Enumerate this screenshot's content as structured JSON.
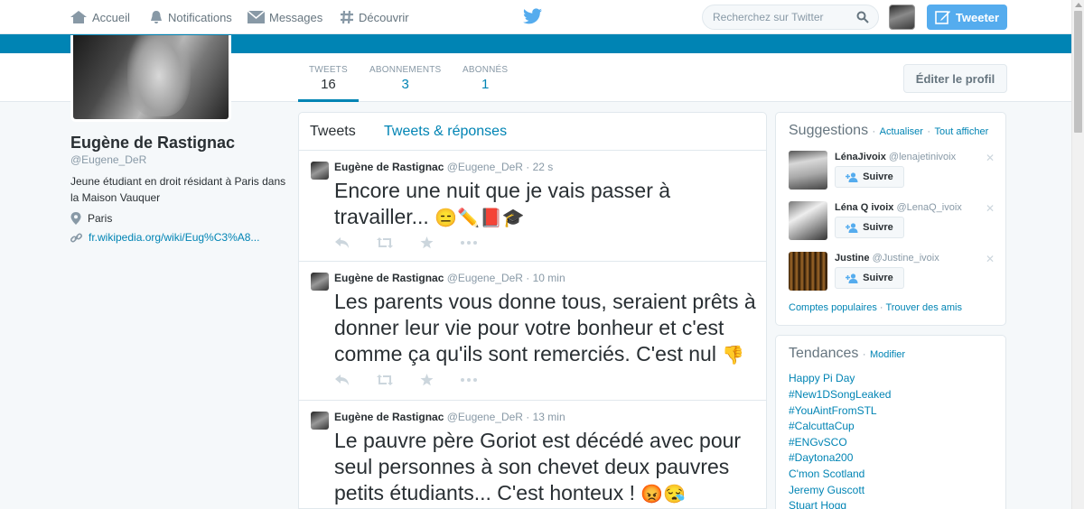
{
  "nav": {
    "home": "Accueil",
    "notifications": "Notifications",
    "messages": "Messages",
    "discover": "Découvrir",
    "search_placeholder": "Recherchez sur Twitter",
    "tweet_button": "Tweeter"
  },
  "stats": {
    "tweets_label": "TWEETS",
    "tweets_value": "16",
    "following_label": "ABONNEMENTS",
    "following_value": "3",
    "followers_label": "ABONNÉS",
    "followers_value": "1",
    "edit_profile": "Éditer le profil"
  },
  "profile": {
    "name": "Eugène de Rastignac",
    "handle": "@Eugene_DeR",
    "bio": "Jeune étudiant en droit résidant à Paris dans la Maison Vauquer",
    "location": "Paris",
    "url": "fr.wikipedia.org/wiki/Eug%C3%A8..."
  },
  "timeline": {
    "tab_tweets": "Tweets",
    "tab_replies": "Tweets & réponses",
    "tweets": [
      {
        "name": "Eugène de Rastignac",
        "handle": "@Eugene_DeR",
        "time": "· 22 s",
        "text": "Encore une nuit que je vais passer à travailler...",
        "emoji": "😑✏️📕🎓"
      },
      {
        "name": "Eugène de Rastignac",
        "handle": "@Eugene_DeR",
        "time": "· 10 min",
        "text": "Les parents vous donne tous, seraient prêts à donner leur vie pour votre bonheur et c'est comme ça qu'ils sont remerciés. C'est nul",
        "emoji": "👎"
      },
      {
        "name": "Eugène de Rastignac",
        "handle": "@Eugene_DeR",
        "time": "· 13 min",
        "text": "Le pauvre père Goriot est décédé avec pour seul personnes à son chevet deux pauvres petits étudiants... C'est honteux !",
        "emoji": "😡😪"
      }
    ]
  },
  "suggestions": {
    "title": "Suggestions",
    "refresh": "Actualiser",
    "view_all": "Tout afficher",
    "follow_label": "Suivre",
    "dismiss": "✕",
    "items": [
      {
        "name": "LénaJivoix",
        "handle": "@lenajetinivoix"
      },
      {
        "name": "Léna Q ivoix",
        "handle": "@LenaQ_ivoix"
      },
      {
        "name": "Justine",
        "handle": "@Justine_ivoix"
      }
    ],
    "popular": "Comptes populaires",
    "find_friends": "Trouver des amis"
  },
  "trends": {
    "title": "Tendances",
    "change": "Modifier",
    "items": [
      "Happy Pi Day",
      "#New1DSongLeaked",
      "#YouAintFromSTL",
      "#CalcuttaCup",
      "#ENGvSCO",
      "#Daytona200",
      "C'mon Scotland",
      "Jeremy Guscott",
      "Stuart Hogg"
    ]
  },
  "colors": {
    "brand_blue": "#55acee",
    "link_blue": "#0084b4",
    "banner": "#0084b4"
  }
}
